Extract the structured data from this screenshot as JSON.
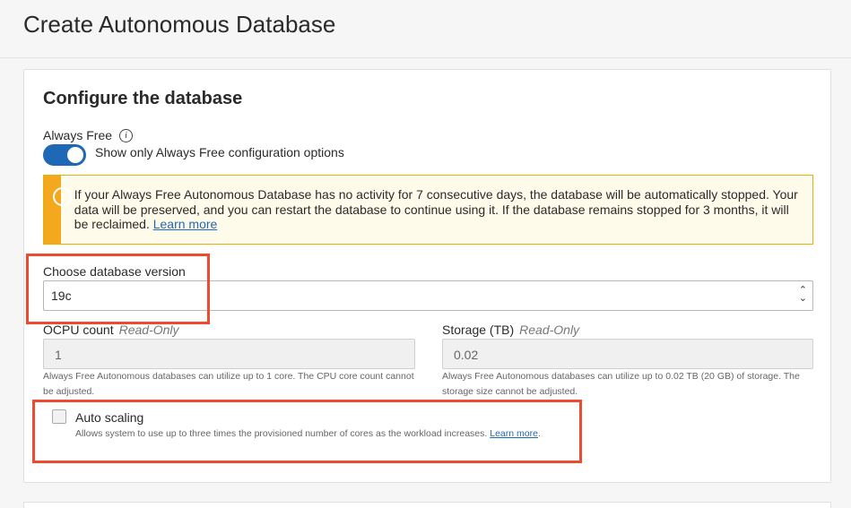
{
  "page": {
    "title": "Create Autonomous Database"
  },
  "section": {
    "title": "Configure the database"
  },
  "always_free": {
    "label": "Always Free",
    "toggle_label": "Show only Always Free configuration options",
    "toggle_on": true
  },
  "banner": {
    "text": "If your Always Free Autonomous Database has no activity for 7 consecutive days, the database will be automatically stopped. Your data will be preserved, and you can restart the database to continue using it. If the database remains stopped for 3 months, it will be reclaimed.",
    "link": "Learn more"
  },
  "db_version": {
    "label": "Choose database version",
    "value": "19c"
  },
  "ocpu": {
    "label": "OCPU count",
    "readonly": "Read-Only",
    "value": "1",
    "help": "Always Free Autonomous databases can utilize up to 1 core. The CPU core count cannot be adjusted."
  },
  "storage": {
    "label": "Storage (TB)",
    "readonly": "Read-Only",
    "value": "0.02",
    "help": "Always Free Autonomous databases can utilize up to 0.02 TB (20 GB) of storage. The storage size cannot be adjusted."
  },
  "auto_scaling": {
    "label": "Auto scaling",
    "checked": false,
    "help": "Allows system to use up to three times the provisioned number of cores as the workload increases.",
    "link": "Learn more"
  },
  "colors": {
    "accent": "#1f68b6",
    "warning": "#f3a81d",
    "highlight": "#ee4a2f"
  }
}
